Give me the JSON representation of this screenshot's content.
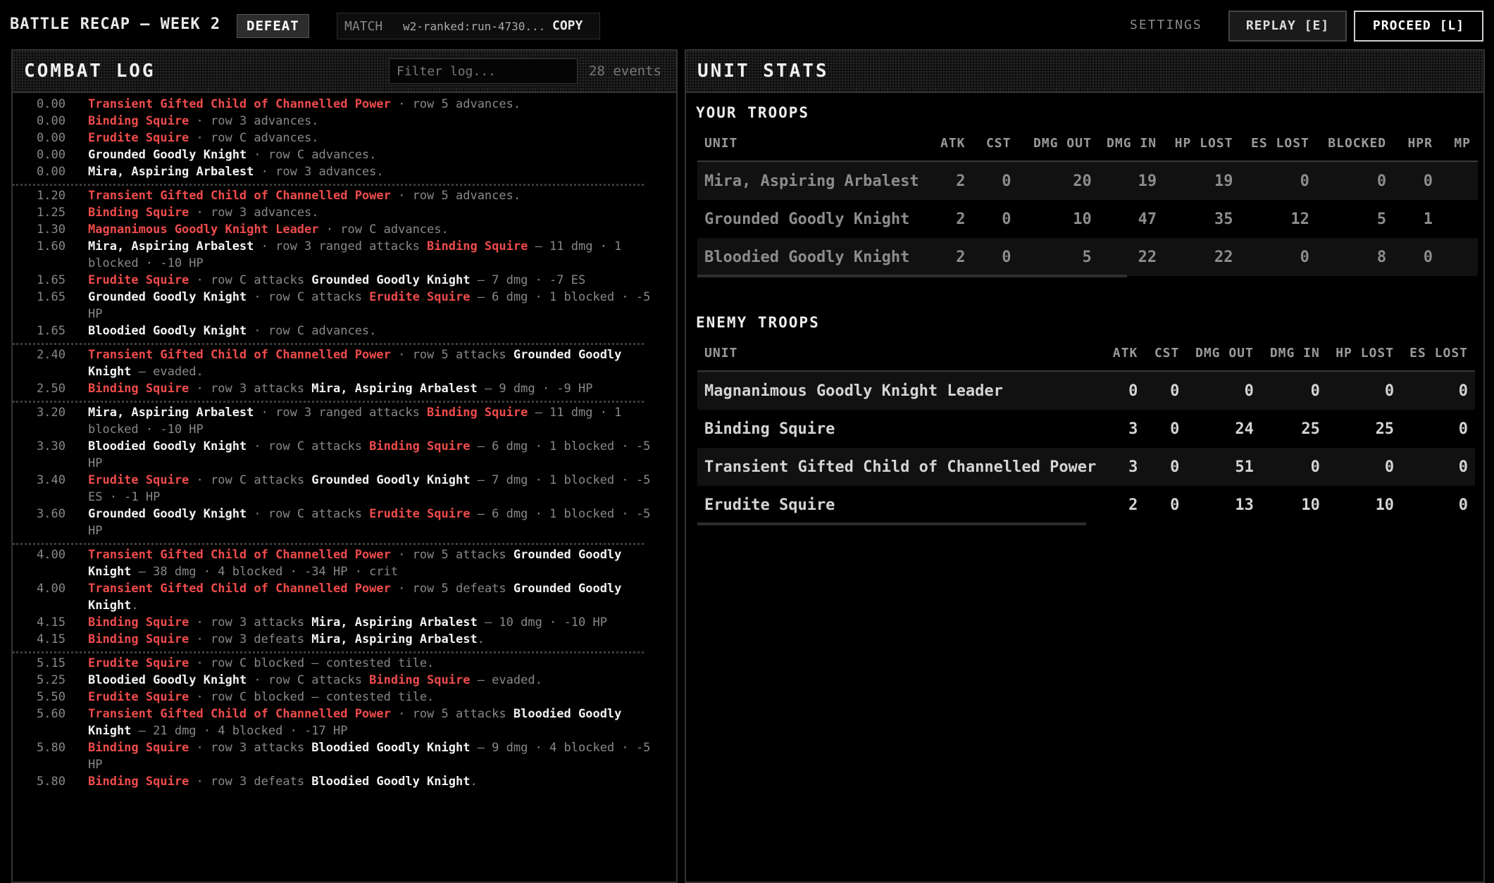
{
  "header": {
    "title": "BATTLE RECAP — WEEK 2",
    "result": "DEFEAT",
    "match_label": "MATCH",
    "match_id": "w2-ranked:run-4730...",
    "copy_label": "COPY",
    "settings_label": "SETTINGS",
    "replay_label": "REPLAY [E]",
    "proceed_label": "PROCEED [L]"
  },
  "log": {
    "title": "COMBAT LOG",
    "filter_placeholder": "Filter log...",
    "events_count": "28 events",
    "colors": {
      "enemy": "#ef4b4b",
      "friendly": "#f2f2f2",
      "detail": "#888888"
    },
    "groups": [
      [
        {
          "t": "0.00",
          "a": {
            "n": "Transient Gifted Child of Channelled Power",
            "s": "enemy"
          },
          "x": " · row 5 advances."
        },
        {
          "t": "0.00",
          "a": {
            "n": "Binding Squire",
            "s": "enemy"
          },
          "x": " · row 3 advances."
        },
        {
          "t": "0.00",
          "a": {
            "n": "Erudite Squire",
            "s": "enemy"
          },
          "x": " · row C advances."
        },
        {
          "t": "0.00",
          "a": {
            "n": "Grounded Goodly Knight",
            "s": "friendly"
          },
          "x": " · row C advances."
        },
        {
          "t": "0.00",
          "a": {
            "n": "Mira, Aspiring Arbalest",
            "s": "friendly"
          },
          "x": " · row 3 advances."
        }
      ],
      [
        {
          "t": "1.20",
          "a": {
            "n": "Transient Gifted Child of Channelled Power",
            "s": "enemy"
          },
          "x": " · row 5 advances."
        },
        {
          "t": "1.25",
          "a": {
            "n": "Binding Squire",
            "s": "enemy"
          },
          "x": " · row 3 advances."
        },
        {
          "t": "1.30",
          "a": {
            "n": "Magnanimous Goodly Knight Leader",
            "s": "enemy"
          },
          "x": " · row C advances."
        },
        {
          "t": "1.60",
          "a": {
            "n": "Mira, Aspiring Arbalest",
            "s": "friendly"
          },
          "x": " · row 3 ranged attacks ",
          "b": {
            "n": "Binding Squire",
            "s": "enemy"
          },
          "y": " — 11 dmg · 1 blocked · -10 HP"
        },
        {
          "t": "1.65",
          "a": {
            "n": "Erudite Squire",
            "s": "enemy"
          },
          "x": " · row C attacks ",
          "b": {
            "n": "Grounded Goodly Knight",
            "s": "friendly"
          },
          "y": " — 7 dmg · -7 ES"
        },
        {
          "t": "1.65",
          "a": {
            "n": "Grounded Goodly Knight",
            "s": "friendly"
          },
          "x": " · row C attacks ",
          "b": {
            "n": "Erudite Squire",
            "s": "enemy"
          },
          "y": " — 6 dmg · 1 blocked · -5 HP"
        },
        {
          "t": "1.65",
          "a": {
            "n": "Bloodied Goodly Knight",
            "s": "friendly"
          },
          "x": " · row C advances."
        }
      ],
      [
        {
          "t": "2.40",
          "a": {
            "n": "Transient Gifted Child of Channelled Power",
            "s": "enemy"
          },
          "x": " · row 5 attacks ",
          "b": {
            "n": "Grounded Goodly Knight",
            "s": "friendly"
          },
          "y": " — evaded."
        },
        {
          "t": "2.50",
          "a": {
            "n": "Binding Squire",
            "s": "enemy"
          },
          "x": " · row 3 attacks ",
          "b": {
            "n": "Mira, Aspiring Arbalest",
            "s": "friendly"
          },
          "y": " — 9 dmg · -9 HP"
        }
      ],
      [
        {
          "t": "3.20",
          "a": {
            "n": "Mira, Aspiring Arbalest",
            "s": "friendly"
          },
          "x": " · row 3 ranged attacks ",
          "b": {
            "n": "Binding Squire",
            "s": "enemy"
          },
          "y": " — 11 dmg · 1 blocked · -10 HP"
        },
        {
          "t": "3.30",
          "a": {
            "n": "Bloodied Goodly Knight",
            "s": "friendly"
          },
          "x": " · row C attacks ",
          "b": {
            "n": "Binding Squire",
            "s": "enemy"
          },
          "y": " — 6 dmg · 1 blocked · -5 HP"
        },
        {
          "t": "3.40",
          "a": {
            "n": "Erudite Squire",
            "s": "enemy"
          },
          "x": " · row C attacks ",
          "b": {
            "n": "Grounded Goodly Knight",
            "s": "friendly"
          },
          "y": " — 7 dmg · 1 blocked · -5 ES · -1 HP"
        },
        {
          "t": "3.60",
          "a": {
            "n": "Grounded Goodly Knight",
            "s": "friendly"
          },
          "x": " · row C attacks ",
          "b": {
            "n": "Erudite Squire",
            "s": "enemy"
          },
          "y": " — 6 dmg · 1 blocked · -5 HP"
        }
      ],
      [
        {
          "t": "4.00",
          "a": {
            "n": "Transient Gifted Child of Channelled Power",
            "s": "enemy"
          },
          "x": " · row 5 attacks ",
          "b": {
            "n": "Grounded Goodly Knight",
            "s": "friendly"
          },
          "y": " — 38 dmg · 4 blocked · -34 HP · crit"
        },
        {
          "t": "4.00",
          "a": {
            "n": "Transient Gifted Child of Channelled Power",
            "s": "enemy"
          },
          "x": " · row 5 defeats ",
          "b": {
            "n": "Grounded Goodly Knight",
            "s": "friendly"
          },
          "y": "."
        },
        {
          "t": "4.15",
          "a": {
            "n": "Binding Squire",
            "s": "enemy"
          },
          "x": " · row 3 attacks ",
          "b": {
            "n": "Mira, Aspiring Arbalest",
            "s": "friendly"
          },
          "y": " — 10 dmg · -10 HP"
        },
        {
          "t": "4.15",
          "a": {
            "n": "Binding Squire",
            "s": "enemy"
          },
          "x": " · row 3 defeats ",
          "b": {
            "n": "Mira, Aspiring Arbalest",
            "s": "friendly"
          },
          "y": "."
        }
      ],
      [
        {
          "t": "5.15",
          "a": {
            "n": "Erudite Squire",
            "s": "enemy"
          },
          "x": " · row C blocked — contested tile."
        },
        {
          "t": "5.25",
          "a": {
            "n": "Bloodied Goodly Knight",
            "s": "friendly"
          },
          "x": " · row C attacks ",
          "b": {
            "n": "Binding Squire",
            "s": "enemy"
          },
          "y": " — evaded."
        },
        {
          "t": "5.50",
          "a": {
            "n": "Erudite Squire",
            "s": "enemy"
          },
          "x": " · row C blocked — contested tile."
        },
        {
          "t": "5.60",
          "a": {
            "n": "Transient Gifted Child of Channelled Power",
            "s": "enemy"
          },
          "x": " · row 5 attacks ",
          "b": {
            "n": "Bloodied Goodly Knight",
            "s": "friendly"
          },
          "y": " — 21 dmg · 4 blocked · -17 HP"
        },
        {
          "t": "5.80",
          "a": {
            "n": "Binding Squire",
            "s": "enemy"
          },
          "x": " · row 3 attacks ",
          "b": {
            "n": "Bloodied Goodly Knight",
            "s": "friendly"
          },
          "y": " — 9 dmg · 4 blocked · -5 HP"
        },
        {
          "t": "5.80",
          "a": {
            "n": "Binding Squire",
            "s": "enemy"
          },
          "x": " · row 3 defeats ",
          "b": {
            "n": "Bloodied Goodly Knight",
            "s": "friendly"
          },
          "y": "."
        }
      ]
    ]
  },
  "stats": {
    "title": "UNIT STATS",
    "your_title": "YOUR TROOPS",
    "your_columns": [
      "UNIT",
      "ATK",
      "CST",
      "DMG OUT",
      "DMG IN",
      "HP LOST",
      "ES LOST",
      "BLOCKED",
      "HPR",
      "MP"
    ],
    "your_rows": [
      [
        "Mira, Aspiring Arbalest",
        "2",
        "0",
        "20",
        "19",
        "19",
        "0",
        "0",
        "0",
        ""
      ],
      [
        "Grounded Goodly Knight",
        "2",
        "0",
        "10",
        "47",
        "35",
        "12",
        "5",
        "1",
        ""
      ],
      [
        "Bloodied Goodly Knight",
        "2",
        "0",
        "5",
        "22",
        "22",
        "0",
        "8",
        "0",
        ""
      ]
    ],
    "enemy_title": "ENEMY TROOPS",
    "enemy_columns": [
      "UNIT",
      "ATK",
      "CST",
      "DMG OUT",
      "DMG IN",
      "HP LOST",
      "ES LOST"
    ],
    "enemy_rows": [
      [
        "Magnanimous Goodly Knight Leader",
        "0",
        "0",
        "0",
        "0",
        "0",
        "0"
      ],
      [
        "Binding Squire",
        "3",
        "0",
        "24",
        "25",
        "25",
        "0"
      ],
      [
        "Transient Gifted Child of Channelled Power",
        "3",
        "0",
        "51",
        "0",
        "0",
        "0"
      ],
      [
        "Erudite Squire",
        "2",
        "0",
        "13",
        "10",
        "10",
        "0"
      ]
    ]
  }
}
